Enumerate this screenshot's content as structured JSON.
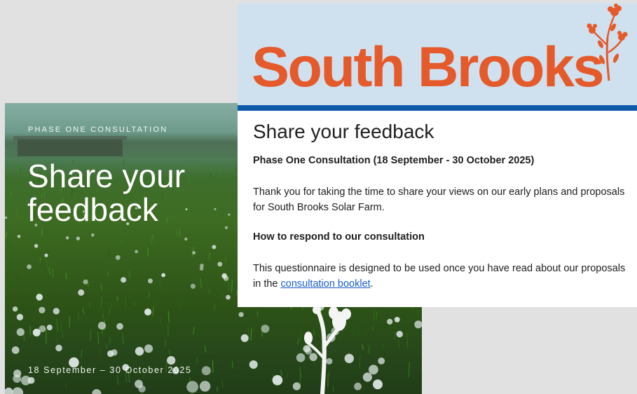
{
  "booklet": {
    "kicker": "PHASE ONE CONSULTATION",
    "title_line1": "Share your",
    "title_line2": "feedback",
    "dates": "18 September – 30 October 2025"
  },
  "form": {
    "brand": "South Brooks",
    "title": "Share your feedback",
    "subtitle": "Phase One Consultation (18 September - 30 October 2025)",
    "intro": "Thank you for taking the time to share your views on our early plans and proposals for South Brooks Solar Farm.",
    "how_heading": "How to respond to our consultation",
    "instructions_before": "This questionnaire is designed to be used once you have read about our proposals in the ",
    "instructions_link": "consultation booklet",
    "instructions_after": "."
  },
  "colors": {
    "brand_orange": "#e55a2a",
    "header_blue": "#cfe0ef",
    "rule_blue": "#0f5aa8",
    "link_blue": "#1a5fc8"
  }
}
